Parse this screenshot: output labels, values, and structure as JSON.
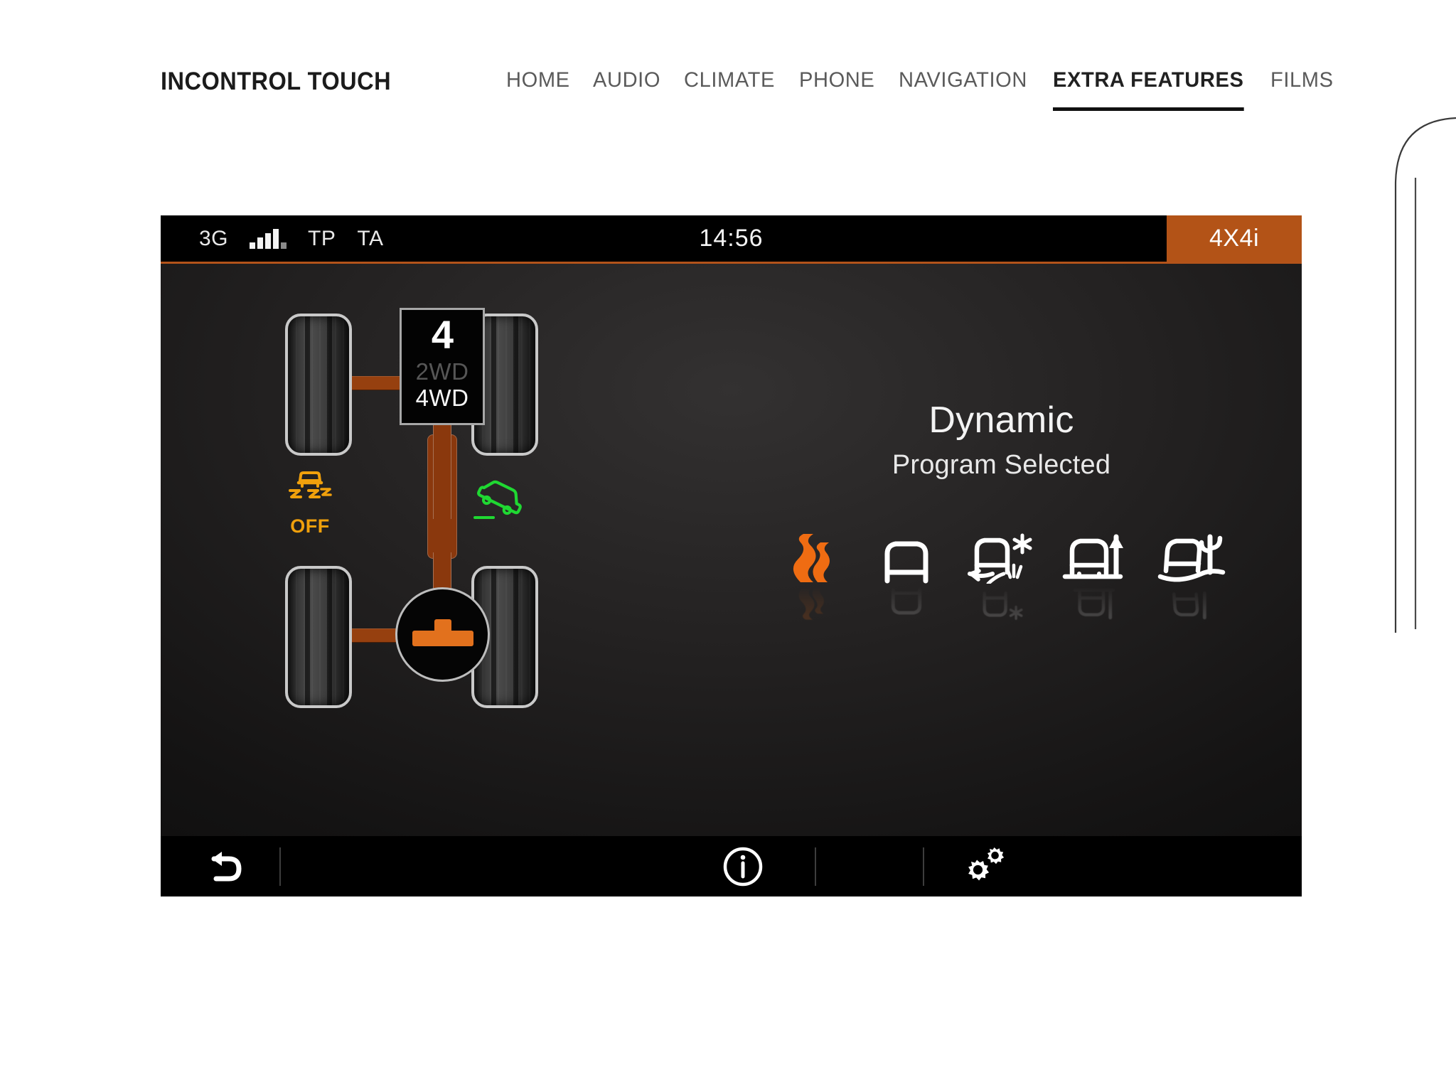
{
  "header": {
    "brand": "INCONTROL TOUCH",
    "nav": [
      {
        "label": "HOME",
        "active": false
      },
      {
        "label": "AUDIO",
        "active": false
      },
      {
        "label": "CLIMATE",
        "active": false
      },
      {
        "label": "PHONE",
        "active": false
      },
      {
        "label": "NAVIGATION",
        "active": false
      },
      {
        "label": "EXTRA FEATURES",
        "active": true
      },
      {
        "label": "FILMS",
        "active": false
      }
    ]
  },
  "ivi": {
    "status_bar": {
      "network": "3G",
      "signal_icon": "signal-bars-icon",
      "signal_bars_active": 4,
      "signal_bars_total": 5,
      "tp": "TP",
      "ta": "TA",
      "clock": "14:56",
      "badge": "4X4i"
    },
    "drivetrain": {
      "transfer_case": {
        "gear": "4",
        "mode_2wd": "2WD",
        "mode_4wd": "4WD",
        "active_mode": "4WD"
      },
      "indicators": [
        {
          "name": "traction-control-off-icon",
          "label": "OFF",
          "color": "#f0a00c"
        },
        {
          "name": "hill-descent-control-icon",
          "label": "",
          "color": "#1fd832"
        }
      ],
      "wheels": [
        "front-left",
        "front-right",
        "rear-left",
        "rear-right"
      ],
      "rear_differential_icon": "rear-differential-icon"
    },
    "program": {
      "title": "Dynamic",
      "subtitle": "Program Selected",
      "modes": [
        {
          "name": "dynamic-mode-icon",
          "label": "Dynamic",
          "selected": true
        },
        {
          "name": "general-driving-mode-icon",
          "label": "General Driving",
          "selected": false
        },
        {
          "name": "grass-gravel-snow-mode-icon",
          "label": "Grass/Gravel/Snow",
          "selected": false
        },
        {
          "name": "mud-ruts-mode-icon",
          "label": "Mud and Ruts",
          "selected": false
        },
        {
          "name": "sand-mode-icon",
          "label": "Sand",
          "selected": false
        }
      ]
    },
    "toolbar": [
      {
        "name": "back-button",
        "icon": "back-arrow-icon"
      },
      {
        "name": "info-button",
        "icon": "info-circle-icon"
      },
      {
        "name": "settings-button",
        "icon": "gears-icon"
      }
    ]
  },
  "colors": {
    "accent_orange": "#e2711d",
    "badge_orange": "#b35317",
    "driveshaft": "#96400f",
    "amber": "#f0a00c",
    "green": "#1fd832",
    "screen_black": "#000000"
  }
}
